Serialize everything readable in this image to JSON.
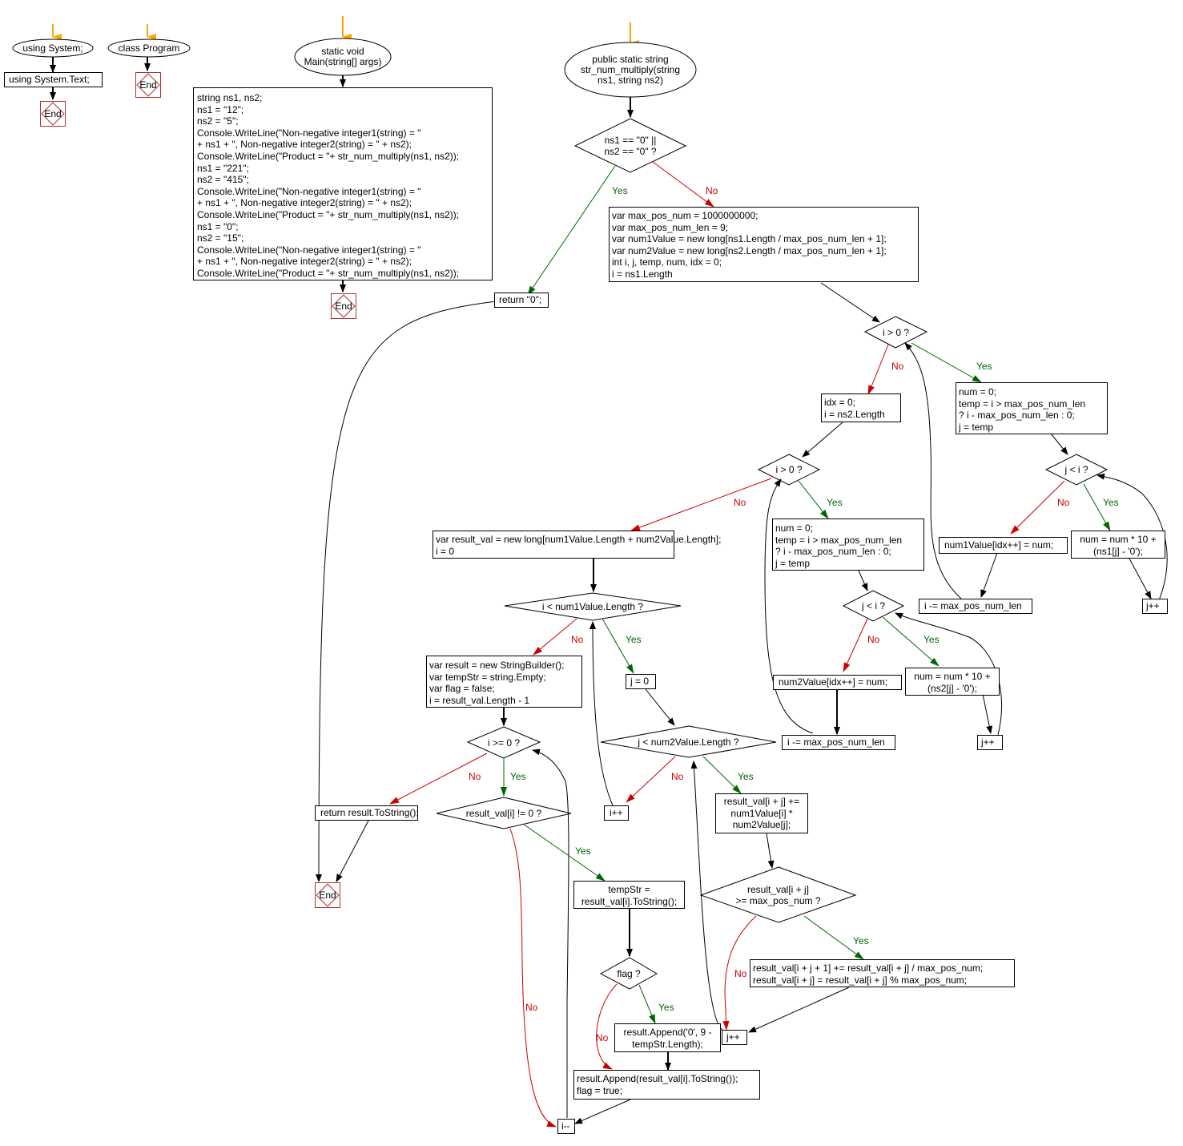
{
  "labels": {
    "yes": "Yes",
    "no": "No",
    "end": "End"
  },
  "colors": {
    "yes_edge": "#006600",
    "no_edge": "#cc0000",
    "start_arrow": "#ffa500",
    "end_border": "#aa3333",
    "edge": "#000000"
  },
  "flow_using": {
    "start": "using System;",
    "stmt": "using System.Text;"
  },
  "flow_class": {
    "start": "class Program"
  },
  "flow_main": {
    "start": "static void\nMain(string[] args)",
    "body": "string ns1, ns2;\nns1 = \"12\";\nns2 = \"5\";\nConsole.WriteLine(\"Non-negative integer1(string) = \"\n+ ns1 + \", Non-negative integer2(string) = \" + ns2);\nConsole.WriteLine(\"Product = \"+ str_num_multiply(ns1, ns2));\nns1 = \"221\";\nns2 = \"415\";\nConsole.WriteLine(\"Non-negative integer1(string) = \"\n+ ns1 + \", Non-negative integer2(string) = \" + ns2);\nConsole.WriteLine(\"Product = \"+ str_num_multiply(ns1, ns2));\nns1 = \"0\";\nns2 = \"15\";\nConsole.WriteLine(\"Non-negative integer1(string) = \"\n+ ns1 + \", Non-negative integer2(string) = \" + ns2);\nConsole.WriteLine(\"Product = \"+ str_num_multiply(ns1, ns2));"
  },
  "flow_multiply": {
    "start": "public static string\nstr_num_multiply(string\nns1, string ns2)",
    "cond_zero": "ns1 == \"0\" ||\nns2 == \"0\" ?",
    "return_zero": "return \"0\";",
    "init": "var max_pos_num = 1000000000;\nvar max_pos_num_len = 9;\nvar num1Value = new long[ns1.Length / max_pos_num_len + 1];\nvar num2Value = new long[ns2.Length / max_pos_num_len + 1];\nint i, j, temp, num, idx = 0;\ni = ns1.Length",
    "cond_i_gt0_a": "i > 0 ?",
    "init_temp_a": "num = 0;\ntemp = i > max_pos_num_len\n? i - max_pos_num_len : 0;\nj = temp",
    "cond_j_lt_i_a": "j < i ?",
    "num_calc_a": "num = num * 10 +\n(ns1[j] - '0');",
    "jinc_a": "j++",
    "assign_num1": "num1Value[idx++] = num;",
    "idec_a": "i -= max_pos_num_len",
    "idx_reset": "idx = 0;\ni = ns2.Length",
    "cond_i_gt0_b": "i > 0 ?",
    "init_temp_b": "num = 0;\ntemp = i > max_pos_num_len\n? i - max_pos_num_len : 0;\nj = temp",
    "cond_j_lt_i_b": "j < i ?",
    "num_calc_b": "num = num * 10 +\n(ns2[j] - '0');",
    "jinc_b": "j++",
    "assign_num2": "num2Value[idx++] = num;",
    "idec_b": "i -= max_pos_num_len",
    "result_init": "var result_val = new long[num1Value.Length + num2Value.Length];\ni = 0",
    "cond_i_lt_num1": "i < num1Value.Length ?",
    "j_zero": "j = 0",
    "cond_j_lt_num2": "j < num2Value.Length ?",
    "iinc": "i++",
    "mult_add": "result_val[i + j] +=\nnum1Value[i] *\nnum2Value[j];",
    "cond_overflow": "result_val[i + j]\n>= max_pos_num ?",
    "carry": "result_val[i + j + 1] += result_val[i + j] / max_pos_num;\nresult_val[i + j] = result_val[i + j] % max_pos_num;",
    "jinc_c": "j++",
    "builder_init": "var result = new StringBuilder();\nvar tempStr = string.Empty;\nvar flag = false;\ni = result_val.Length - 1",
    "cond_i_ge0": "i >= 0 ?",
    "return_result": "return result.ToString();",
    "cond_nonzero": "result_val[i] != 0 ?",
    "tempstr": "tempStr =\nresult_val[i].ToString();",
    "cond_flag": "flag ?",
    "append_pad": "result.Append('0', 9 -\ntempStr.Length);",
    "append_val": "result.Append(result_val[i].ToString());\nflag = true;",
    "idec_c": "i--"
  }
}
